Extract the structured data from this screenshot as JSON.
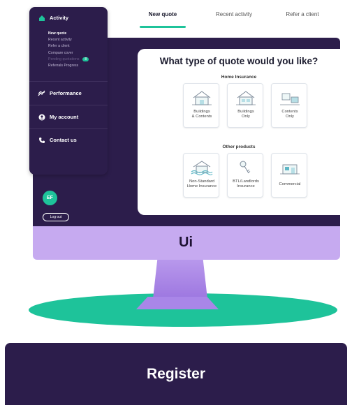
{
  "tabs": [
    {
      "label": "New quote",
      "active": true
    },
    {
      "label": "Recent activity",
      "active": false
    },
    {
      "label": "Refer a client",
      "active": false
    }
  ],
  "sidebar": {
    "activity_label": "Activity",
    "activity_items": [
      {
        "label": "New quote",
        "active": true
      },
      {
        "label": "Recent activity"
      },
      {
        "label": "Refer a client"
      },
      {
        "label": "Compare cover"
      },
      {
        "label": "Pending quotations",
        "count": "8"
      },
      {
        "label": "Referrals Progress"
      }
    ],
    "performance_label": "Performance",
    "my_account_label": "My account",
    "contact_label": "Contact us"
  },
  "user": {
    "initials": "EF",
    "logout_label": "Log out"
  },
  "panel": {
    "title": "What type of quote would you like?",
    "home_section": "Home Insurance",
    "home_cards": [
      {
        "line1": "Buildings",
        "line2": "& Contents"
      },
      {
        "line1": "Buildings",
        "line2": "Only"
      },
      {
        "line1": "Contents",
        "line2": "Only"
      }
    ],
    "other_section": "Other products",
    "other_cards": [
      {
        "line1": "Non-Standard",
        "line2": "Home Insurance"
      },
      {
        "line1": "BTL/Landlords",
        "line2": "Insurance"
      },
      {
        "line1": "Commercial",
        "line2": ""
      }
    ]
  },
  "brand": {
    "monitor_logo": "Ui"
  },
  "register": {
    "label": "Register"
  },
  "colors": {
    "brand_purple": "#2c1d4b",
    "accent_green": "#1ec39a",
    "monitor_lilac": "#c6aaf0"
  }
}
